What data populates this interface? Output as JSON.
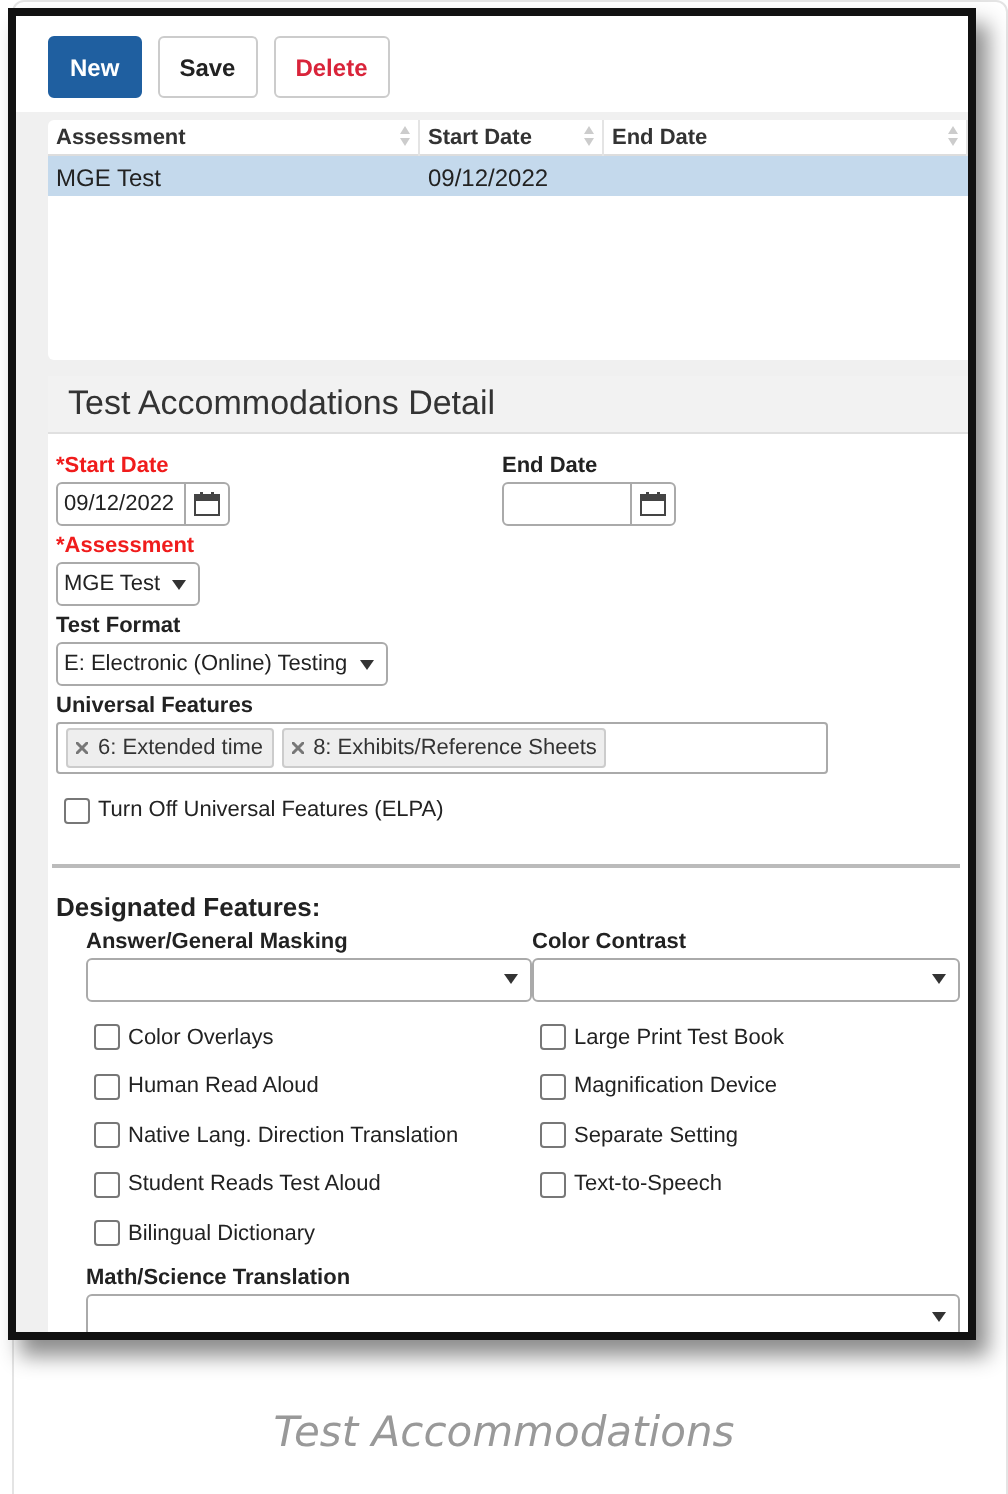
{
  "toolbar": [
    {
      "label": "New",
      "kind": "primary"
    },
    {
      "label": "Save",
      "kind": "default"
    },
    {
      "label": "Delete",
      "kind": "danger"
    }
  ],
  "table": {
    "columns": [
      "Assessment",
      "Start Date",
      "End Date"
    ],
    "rows": [
      {
        "cells": [
          "MGE Test",
          "09/12/2022"
        ],
        "selected": true
      }
    ]
  },
  "detail": {
    "title": "Test Accommodations Detail",
    "start_date": {
      "label": "*Start Date",
      "required": true,
      "value": "09/12/2022"
    },
    "end_date": {
      "label": "End Date",
      "required": false
    },
    "assessment": {
      "label": "*Assessment",
      "required": true,
      "value": "MGE Test"
    },
    "test_format": {
      "label": "Test Format",
      "required": false,
      "value": "E: Electronic (Online) Testing"
    },
    "universal_features": {
      "label": "Universal Features",
      "tags": [
        "6: Extended time",
        "8: Exhibits/Reference Sheets"
      ]
    },
    "turn_off": {
      "label": "Turn Off Universal Features (ELPA)",
      "checked": false
    },
    "designated": {
      "title": "Designated Features:",
      "masking": {
        "label": "Answer/General Masking"
      },
      "contrast": {
        "label": "Color Contrast"
      },
      "left_checks": [
        {
          "label": "Color Overlays",
          "checked": false
        },
        {
          "label": "Human Read Aloud",
          "checked": false
        },
        {
          "label": "Native Lang. Direction Translation",
          "checked": false
        },
        {
          "label": "Student Reads Test Aloud",
          "checked": false
        },
        {
          "label": "Bilingual Dictionary",
          "checked": false
        }
      ],
      "right_checks": [
        {
          "label": "Large Print Test Book",
          "checked": false
        },
        {
          "label": "Magnification Device",
          "checked": false
        },
        {
          "label": "Separate Setting",
          "checked": false
        },
        {
          "label": "Text-to-Speech",
          "checked": false
        }
      ],
      "math": {
        "label": "Math/Science Translation"
      }
    }
  },
  "caption": "Test Accommodations"
}
